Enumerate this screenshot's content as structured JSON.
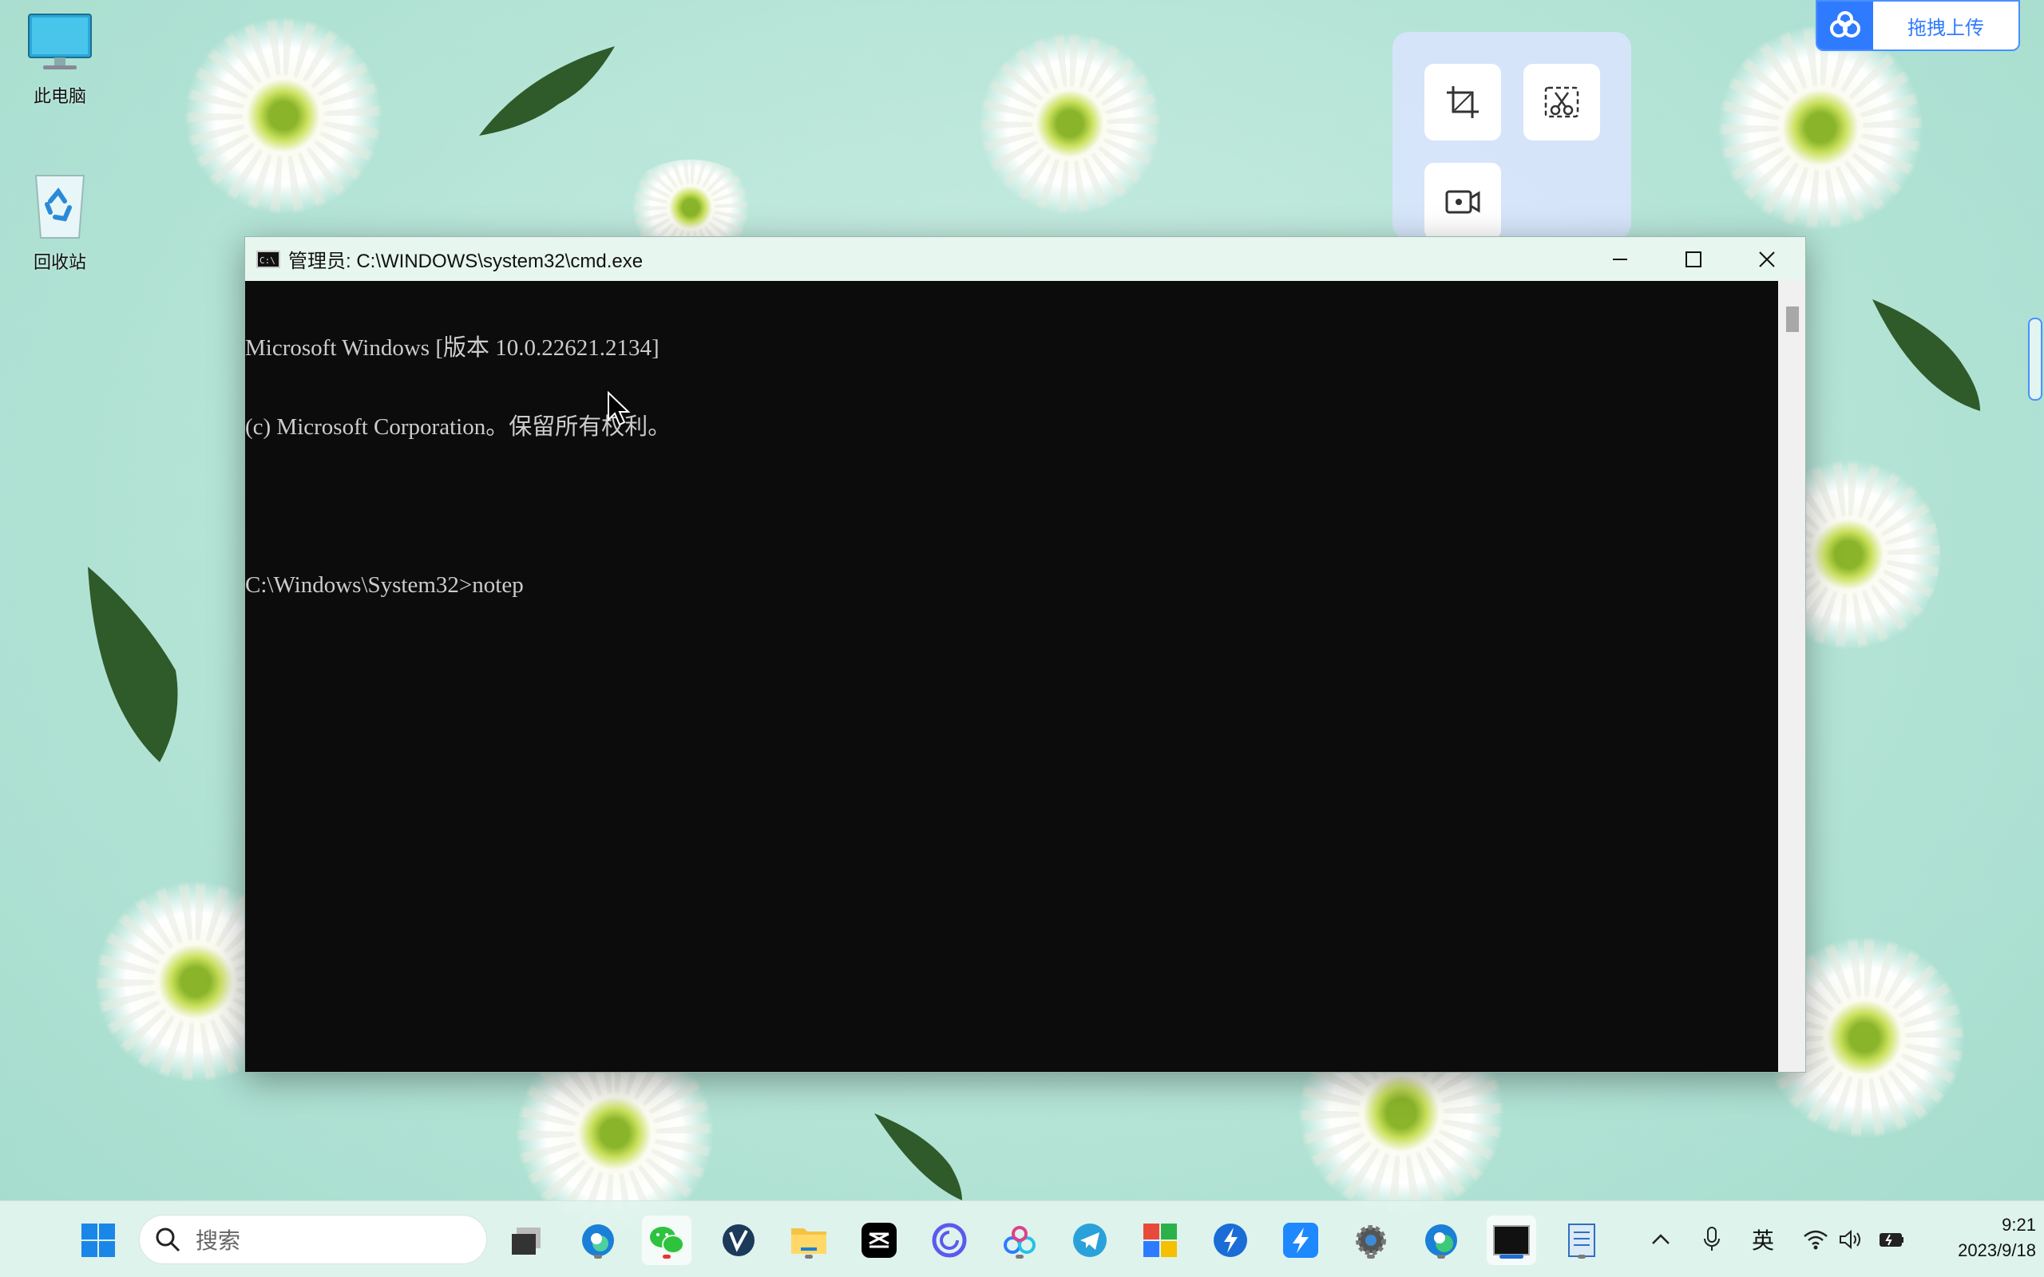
{
  "desktop": {
    "icons": [
      {
        "label": "此电脑"
      },
      {
        "label": "回收站"
      }
    ]
  },
  "upload_widget": {
    "label": "拖拽上传"
  },
  "cmd_window": {
    "title": "管理员: C:\\WINDOWS\\system32\\cmd.exe",
    "lines": [
      "Microsoft Windows [版本 10.0.22621.2134]",
      "(c) Microsoft Corporation。保留所有权利。",
      "",
      "C:\\Windows\\System32>notep"
    ]
  },
  "taskbar": {
    "search_placeholder": "搜索",
    "ime_label": "英",
    "clock": {
      "time": "9:21",
      "date": "2023/9/18"
    },
    "apps": [
      "start-icon",
      "task-view-icon",
      "edge-beta-icon",
      "wechat-icon",
      "vscode-like-icon",
      "file-explorer-icon",
      "capcut-icon",
      "refresh-app-icon",
      "baidu-netdisk-icon",
      "telegram-icon",
      "office-icon",
      "thunder-icon",
      "feishu-icon",
      "settings-icon",
      "edge-icon",
      "terminal-icon",
      "notepad-icon"
    ]
  },
  "colors": {
    "desktop_bg": "#b4e4d6",
    "cmd_bg": "#0c0c0c",
    "cmd_text": "#cccccc",
    "titlebar_bg": "#e7f6ef",
    "accent": "#2f7bff"
  }
}
